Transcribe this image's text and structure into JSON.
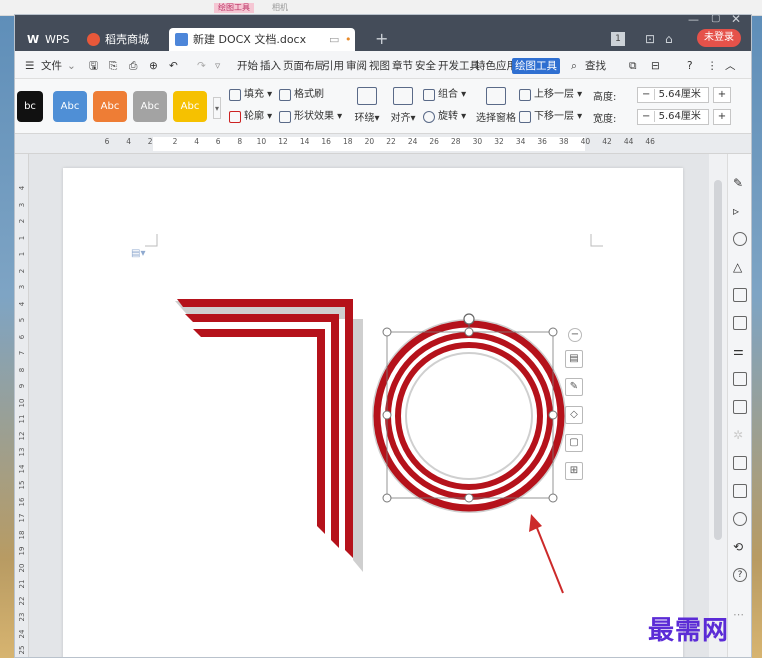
{
  "desktop": {
    "tags": [
      "绘图工具",
      "相机"
    ]
  },
  "tabs": [
    {
      "label": "WPS"
    },
    {
      "label": "稻壳商城"
    },
    {
      "label": "新建 DOCX 文档.docx"
    }
  ],
  "titlebar": {
    "add_tab": "+",
    "login": "未登录",
    "badge": "1"
  },
  "menubar": {
    "file": "文件",
    "items": [
      "开始",
      "插入",
      "页面布局",
      "引用",
      "审阅",
      "视图",
      "章节",
      "安全",
      "开发工具",
      "特色应用",
      "绘图工具"
    ],
    "active_item": "绘图工具",
    "search": "查找"
  },
  "ribbon": {
    "styles": [
      {
        "label": "bc",
        "color": "#111111"
      },
      {
        "label": "Abc",
        "color": "#4f8fd6"
      },
      {
        "label": "Abc",
        "color": "#ee7d35"
      },
      {
        "label": "Abc",
        "color": "#a3a3a3"
      },
      {
        "label": "Abc",
        "color": "#f6c100"
      }
    ],
    "fill": "填充",
    "format_painter": "格式刷",
    "outline": "轮廓",
    "shape_effect": "形状效果",
    "wrap": "环绕",
    "align": "对齐",
    "group": "组合",
    "rotate": "旋转",
    "selection_pane": "选择窗格",
    "bring_forward": "上移一层",
    "send_backward": "下移一层",
    "height_label": "高度:",
    "width_label": "宽度:",
    "height_value": "5.64厘米",
    "width_value": "5.64厘米",
    "minus": "−",
    "plus": "+"
  },
  "ruler": {
    "ticks": [
      "6",
      "4",
      "2",
      "2",
      "4",
      "6",
      "8",
      "10",
      "12",
      "14",
      "16",
      "18",
      "20",
      "22",
      "24",
      "26",
      "28",
      "30",
      "32",
      "34",
      "36",
      "38",
      "40",
      "42",
      "44",
      "46"
    ]
  },
  "vruler": {
    "ticks": [
      "4",
      "3",
      "2",
      "1",
      "1",
      "2",
      "3",
      "4",
      "5",
      "6",
      "7",
      "8",
      "9",
      "10",
      "11",
      "12",
      "13",
      "14",
      "15",
      "16",
      "17",
      "18",
      "19",
      "20",
      "21",
      "22",
      "23",
      "24",
      "25"
    ]
  },
  "watermark": "最需网",
  "colors": {
    "shape_red": "#b5121b",
    "shape_gray": "#c9c9c9",
    "accent": "#2f6fd1",
    "arrow": "#cc2a2a"
  }
}
